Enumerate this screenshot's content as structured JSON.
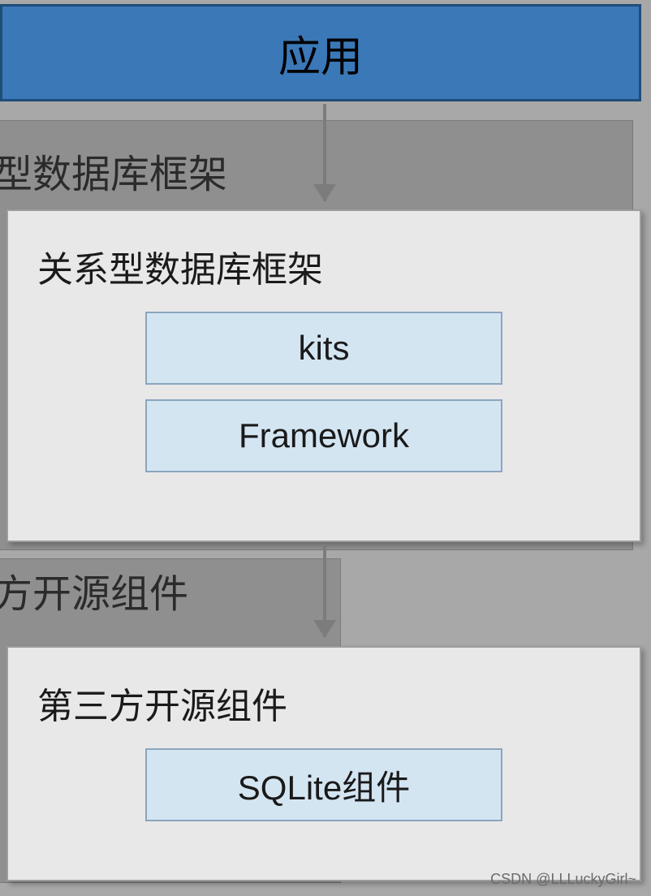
{
  "application": {
    "label": "应用"
  },
  "bg_labels": {
    "framework_partial": "型数据库框架",
    "thirdparty_partial": "方开源组件"
  },
  "framework_card": {
    "title": "关系型数据库框架",
    "box1": "kits",
    "box2": "Framework"
  },
  "thirdparty_card": {
    "title": "第三方开源组件",
    "box1": "SQLite组件"
  },
  "watermark": "CSDN @LLLuckyGirl~",
  "colors": {
    "app_fill": "#3b78b8",
    "app_border": "#1f4d7a",
    "card_fill": "#e8e8e8",
    "inner_fill": "#d4e5f2",
    "bg": "#a8a8a8"
  }
}
